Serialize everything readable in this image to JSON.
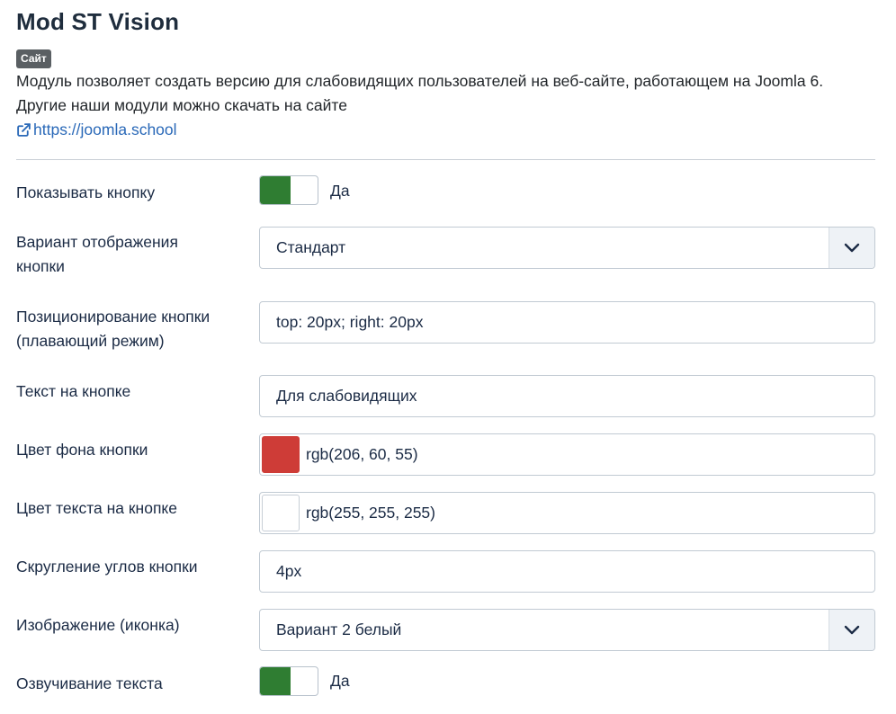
{
  "header": {
    "title": "Mod ST Vision",
    "badge": "Сайт",
    "description_line1": "Модуль позволяет создать версию для слабовидящих пользователей на веб-сайте, работающем на Joomla 6.",
    "description_line2": "Другие наши модули можно скачать на сайте",
    "link_text": "https://joomla.school"
  },
  "fields": {
    "show_button": {
      "label": "Показывать кнопку",
      "value": "Да"
    },
    "display_variant": {
      "label_line1": "Вариант отображения",
      "label_line2": "кнопки",
      "value": "Стандарт"
    },
    "positioning": {
      "label_line1": "Позиционирование кнопки",
      "label_line2": "(плавающий режим)",
      "value": "top: 20px; right: 20px"
    },
    "button_text": {
      "label": "Текст на кнопке",
      "value": "Для слабовидящих"
    },
    "bg_color": {
      "label": "Цвет фона кнопки",
      "value": "rgb(206, 60, 55)",
      "swatch": "#ce3c37"
    },
    "text_color": {
      "label": "Цвет текста на кнопке",
      "value": "rgb(255, 255, 255)",
      "swatch": "#ffffff"
    },
    "border_radius": {
      "label": "Скругление углов кнопки",
      "value": "4px"
    },
    "image_icon": {
      "label": "Изображение (иконка)",
      "value": "Вариант 2 белый"
    },
    "text_to_speech": {
      "label": "Озвучивание текста",
      "value": "Да"
    }
  },
  "colors": {
    "toggle_on": "#2f7d32",
    "link": "#2a69b8"
  },
  "icons": {
    "link": "external-link-icon",
    "select": "chevron-down-icon"
  }
}
